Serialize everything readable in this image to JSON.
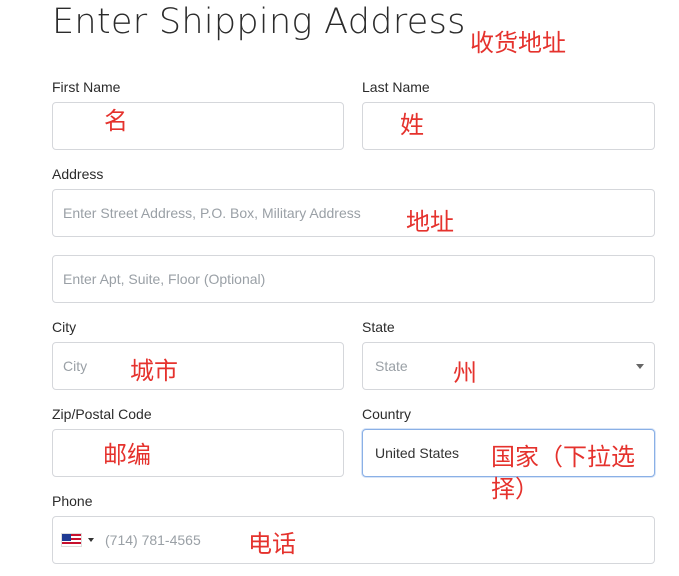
{
  "form": {
    "title": "Enter Shipping Address",
    "title_note": "收货地址",
    "first_name": {
      "label": "First Name",
      "value": "",
      "note": "名"
    },
    "last_name": {
      "label": "Last Name",
      "value": "",
      "note": "姓"
    },
    "address": {
      "label": "Address",
      "line1_placeholder": "Enter Street Address, P.O. Box, Military Address",
      "line2_placeholder": "Enter Apt, Suite, Floor (Optional)",
      "note": "地址"
    },
    "city": {
      "label": "City",
      "placeholder": "City",
      "note": "城市"
    },
    "state": {
      "label": "State",
      "placeholder": "State",
      "note": "州"
    },
    "zip": {
      "label": "Zip/Postal Code",
      "value": "",
      "note": "邮编"
    },
    "country": {
      "label": "Country",
      "value": "United States",
      "note_line1": "国家（下拉选",
      "note_line2": "择）"
    },
    "phone": {
      "label": "Phone",
      "placeholder": "(714) 781-4565",
      "note": "电话",
      "flag_icon": "us-flag-icon"
    }
  },
  "colors": {
    "annotation": "#e5322d",
    "border": "#d5d7db",
    "focus_border": "#8ab0e6"
  }
}
